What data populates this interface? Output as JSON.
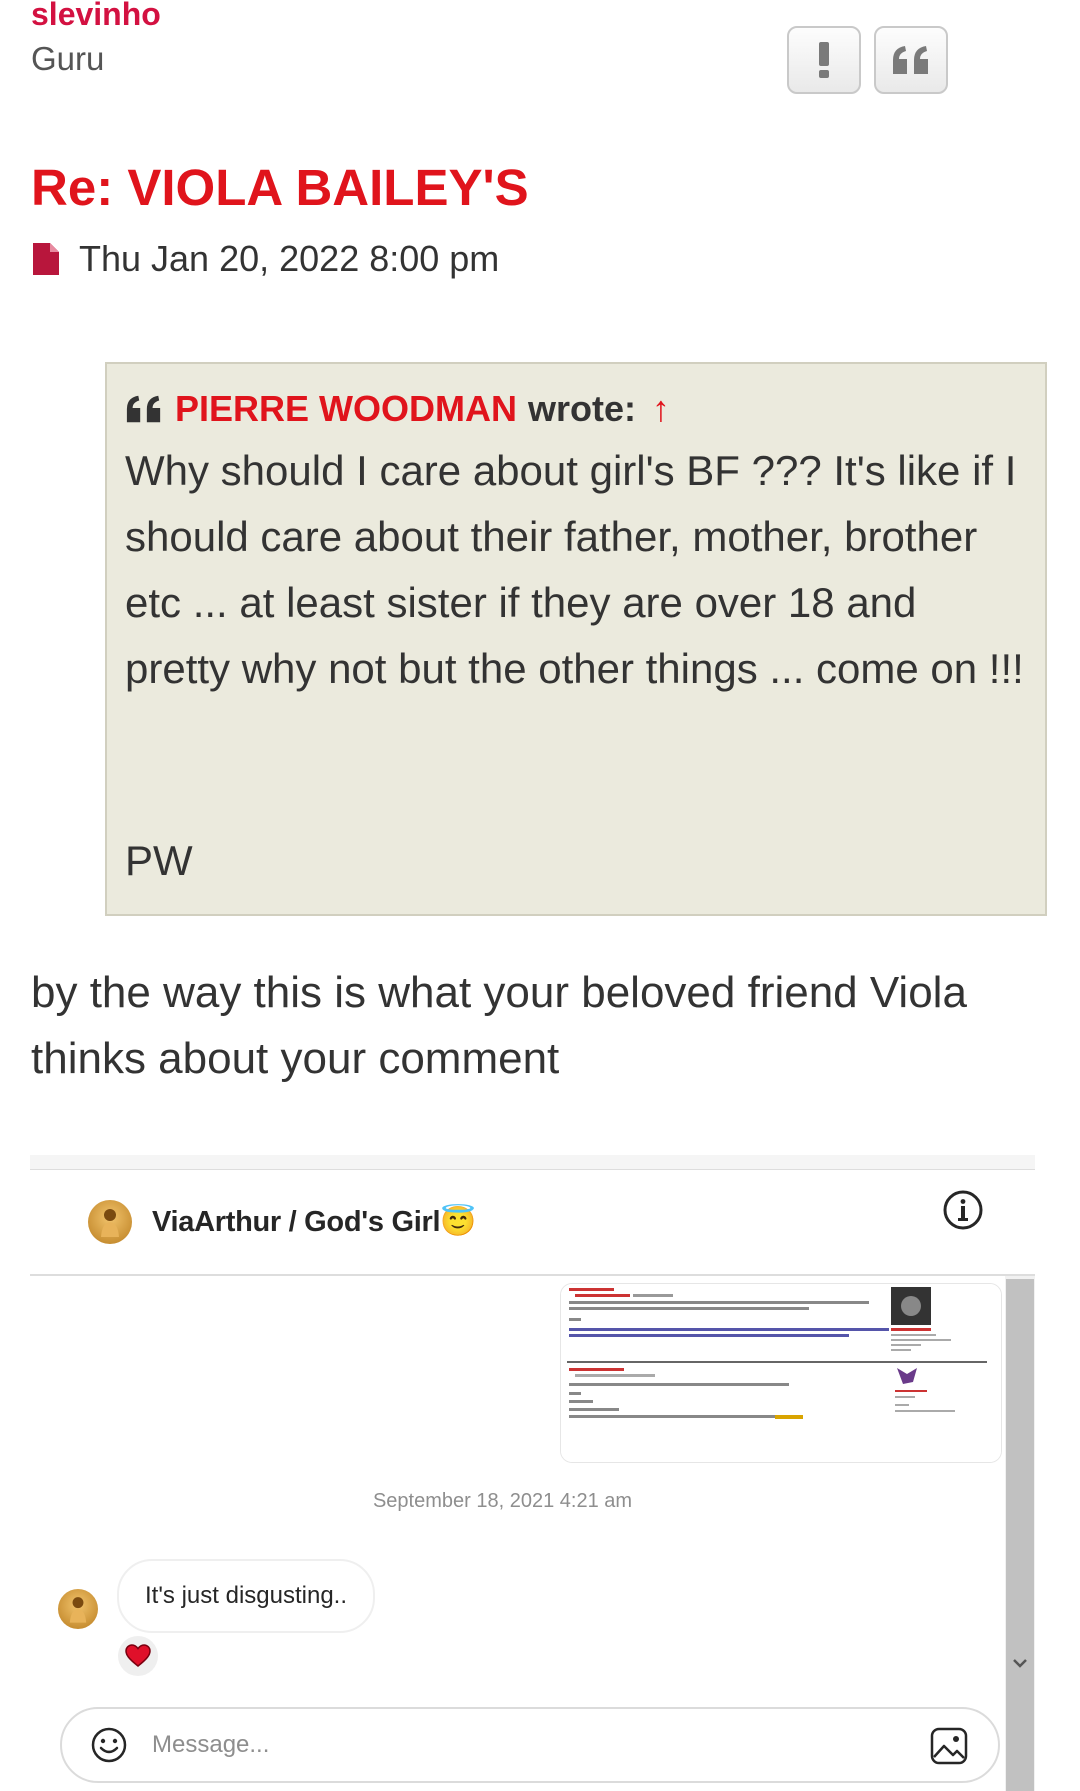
{
  "post": {
    "author": "slevinho",
    "rank": "Guru",
    "title": "Re: VIOLA BAILEY'S",
    "datetime": "Thu Jan 20, 2022 8:00 pm",
    "buttons": {
      "report": "!",
      "quote": "quote"
    }
  },
  "quote": {
    "author": "PIERRE WOODMAN",
    "wrote": "wrote:",
    "arrow": "↑",
    "body": "Why should I care about girl's BF ??? It's like if I should care about their father, mother, brother etc ... at least sister if they are over 18 and pretty why not but the other things ... come on !!!",
    "signature": "PW"
  },
  "post_text": "by the way this is what your beloved friend Viola thinks about your comment",
  "chat": {
    "name": "ViaArthur / God's Girl",
    "name_emoji": "😇",
    "timestamp": "September 18, 2021 4:21 am",
    "message": "It's just disgusting..",
    "reaction": "❤️",
    "input_placeholder": "Message..."
  },
  "colors": {
    "brand_red": "#e0141c",
    "author_red": "#d31141",
    "quote_bg": "#ebeadd"
  }
}
